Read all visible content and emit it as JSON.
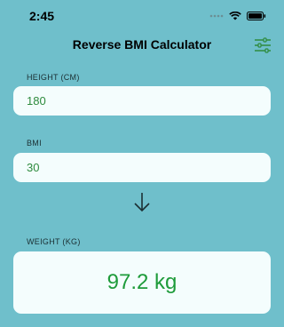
{
  "status_bar": {
    "time": "2:45",
    "icons": [
      "signal-dots-icon",
      "wifi-icon",
      "battery-icon"
    ]
  },
  "nav": {
    "title": "Reverse BMI Calculator",
    "settings_icon": "sliders-icon"
  },
  "height_field": {
    "label": "HEIGHT (CM)",
    "value": "180"
  },
  "bmi_field": {
    "label": "BMI",
    "value": "30"
  },
  "arrow_icon": "arrow-down-icon",
  "weight_result": {
    "label": "WEIGHT (KG)",
    "value": "97.2 kg"
  },
  "colors": {
    "background": "#6fbfcb",
    "card": "#f4fdfd",
    "accent_green": "#2e8b3e",
    "result_green": "#1e9b3a"
  }
}
